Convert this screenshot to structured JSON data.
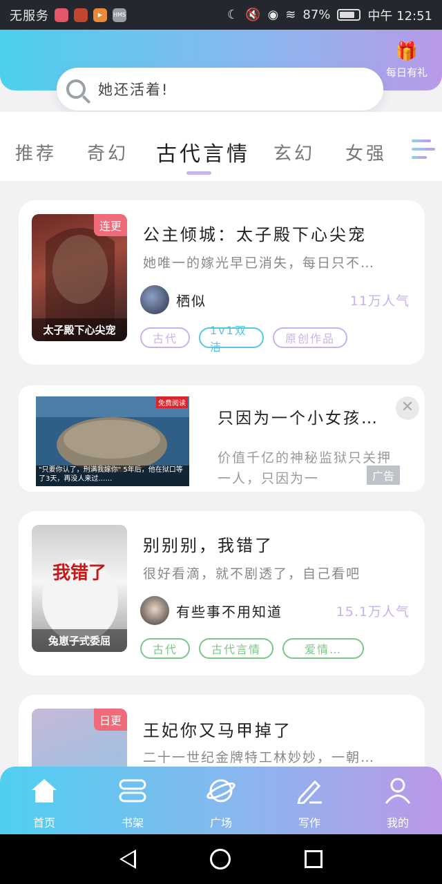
{
  "status_bar": {
    "carrier": "无服务",
    "battery": "87%",
    "time": "中午 12:51",
    "app_icons": [
      "app-icon-red",
      "app-icon-brown",
      "app-icon-orange",
      "hms-icon"
    ]
  },
  "header": {
    "gift_label": "每日有礼",
    "search_placeholder": "她还活着!"
  },
  "tabs": [
    "推荐",
    "奇幻",
    "古代言情",
    "玄幻",
    "女强"
  ],
  "active_tab": "古代言情",
  "books": [
    {
      "title": "公主倾城：太子殿下心尖宠",
      "desc": "她唯一的嫁光早已消失，每日只不…",
      "author": "栖似",
      "popularity": "11万人气",
      "badge": "连更",
      "cover_caption": "太子殿下心尖宠",
      "tags": [
        "古代",
        "1v1双洁",
        "原创作品"
      ]
    },
    {
      "title": "别别别，我错了",
      "desc": "很好看滴，就不剧透了，自己看吧",
      "author": "有些事不用知道",
      "popularity": "15.1万人气",
      "badge": "",
      "cover_caption": "兔崽子式委屈",
      "tags": [
        "古代",
        "古代言情",
        "爱情…"
      ]
    },
    {
      "title": "王妃你又马甲掉了",
      "desc": "二十一世纪金牌特工林妙妙，一朝…",
      "author": "",
      "popularity": "",
      "badge": "日更",
      "cover_caption": "",
      "tags": []
    }
  ],
  "ad": {
    "title": "只因为一个小女孩…",
    "desc": "价值千亿的神秘监狱只关押一人，只因为一",
    "badge": "广告",
    "image_caption": "\"只要你认了，刑满我嫁你\" 5年后，他在狱口等了3天，再没人来过……",
    "image_tag": "免费阅读"
  },
  "bottom_nav": [
    "首页",
    "书架",
    "广场",
    "写作",
    "我的"
  ],
  "colors": {
    "header_start": "#4cd0ee",
    "header_end": "#b89ae8",
    "tag_purple": "#c9b0f0",
    "tag_blue": "#55c6ea",
    "tag_green": "#7cc587",
    "badge_red": "#f06b7a"
  }
}
